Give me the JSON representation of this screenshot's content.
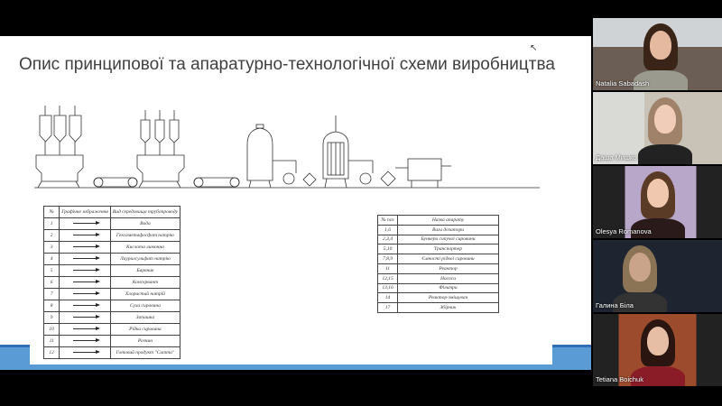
{
  "slide": {
    "title": "Опис принципової та апаратурно-технологічної схеми виробництва",
    "pipeline_table": {
      "headers": [
        "№",
        "Графічне зображення",
        "Вид середовища трубопроводу"
      ],
      "rows": [
        {
          "num": "1",
          "name": "Вода"
        },
        {
          "num": "2",
          "name": "Гексаметафосфат натрію"
        },
        {
          "num": "3",
          "name": "Кислота лимонна"
        },
        {
          "num": "4",
          "name": "Лаурилсульфат натрію"
        },
        {
          "num": "5",
          "name": "Барвник"
        },
        {
          "num": "6",
          "name": "Консервант"
        },
        {
          "num": "7",
          "name": "Хлористий натрій"
        },
        {
          "num": "8",
          "name": "Суха сировина"
        },
        {
          "num": "9",
          "name": "Запашка"
        },
        {
          "num": "10",
          "name": "Рідка сировина"
        },
        {
          "num": "11",
          "name": "Розчин"
        },
        {
          "num": "12",
          "name": "Готовий продукт \"Сатта\""
        }
      ]
    },
    "equipment_table": {
      "headers": [
        "№ поз",
        "Назва апарату"
      ],
      "rows": [
        {
          "num": "1,6",
          "name": "Ваги дозатори"
        },
        {
          "num": "2,3,4",
          "name": "Бункери сипучої сировини"
        },
        {
          "num": "5,10",
          "name": "Транспортер"
        },
        {
          "num": "7,8,9",
          "name": "Ємності рідкої сировини"
        },
        {
          "num": "11",
          "name": "Реактор"
        },
        {
          "num": "12,15",
          "name": "Насоси"
        },
        {
          "num": "13,16",
          "name": "Фільтри"
        },
        {
          "num": "14",
          "name": "Реактор-змішувач"
        },
        {
          "num": "17",
          "name": "Збірник"
        }
      ]
    }
  },
  "participants": [
    {
      "name": "Natalia Sabadash"
    },
    {
      "name": "Даша Мишко"
    },
    {
      "name": "Olesya Romanova"
    },
    {
      "name": "Галина Біла"
    },
    {
      "name": "Tetiana Boichuk"
    }
  ],
  "colors": {
    "background": "#000000",
    "slide_band": "#5b9bd5",
    "slide_band_edge": "#2e6fb8",
    "title_text": "#404040"
  }
}
